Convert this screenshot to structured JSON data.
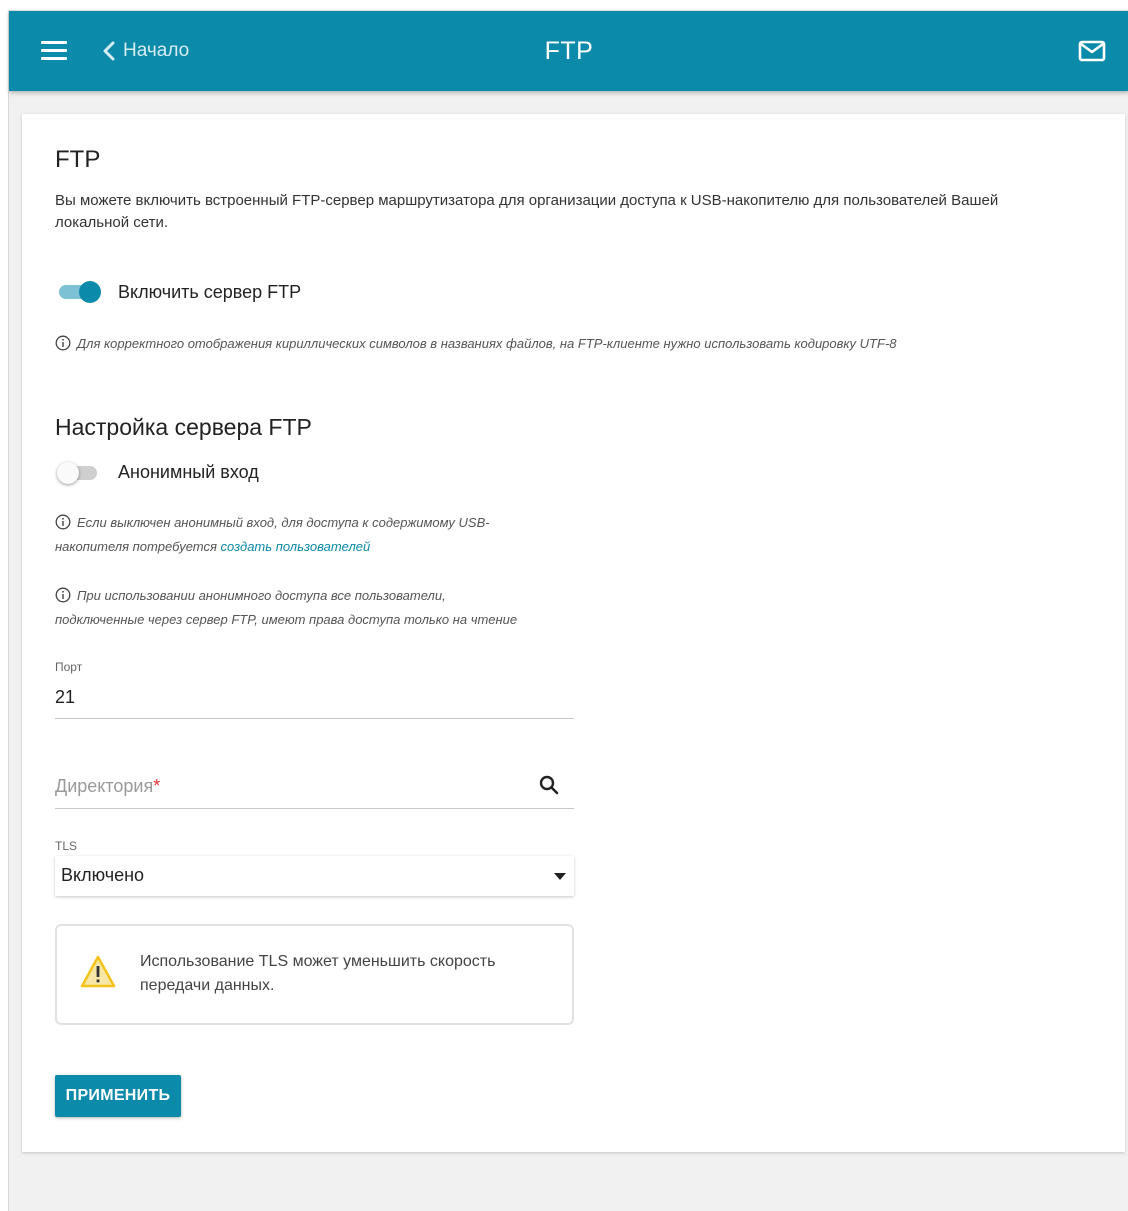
{
  "header": {
    "back_label": "Начало",
    "title": "FTP",
    "menu_icon": "hamburger-menu-icon",
    "back_icon": "chevron-left-icon",
    "mail_icon": "mail-icon"
  },
  "ftp": {
    "title": "FTP",
    "description": "Вы можете включить встроенный FTP-сервер маршрутизатора для организации доступа к USB-накопителю для пользователей Вашей локальной сети.",
    "enable_label": "Включить сервер FTP",
    "enable_state": true,
    "encoding_note": "Для корректного отображения кириллических символов в названиях файлов, на FTP-клиенте нужно использовать кодировку UTF-8"
  },
  "server_settings": {
    "title": "Настройка сервера FTP",
    "anonymous_label": "Анонимный вход",
    "anonymous_state": false,
    "note_users_prefix": "Если выключен анонимный вход, для доступа к содержимому USB-",
    "note_users_line2": "накопителя потребуется ",
    "note_users_link": "создать пользователей",
    "note_anon_line1": "При использовании анонимного доступа все пользователи,",
    "note_anon_line2": "подключенные через сервер FTP, имеют права доступа только на чтение",
    "port_label": "Порт",
    "port_value": "21",
    "directory_placeholder": "Директория",
    "directory_required_mark": "*",
    "tls_label": "TLS",
    "tls_value": "Включено",
    "tls_warning": "Использование TLS может уменьшить скорость передачи данных."
  },
  "actions": {
    "apply_label": "ПРИМЕНИТЬ"
  },
  "colors": {
    "accent": "#0b8aa9",
    "warning": "#f3c21b"
  }
}
